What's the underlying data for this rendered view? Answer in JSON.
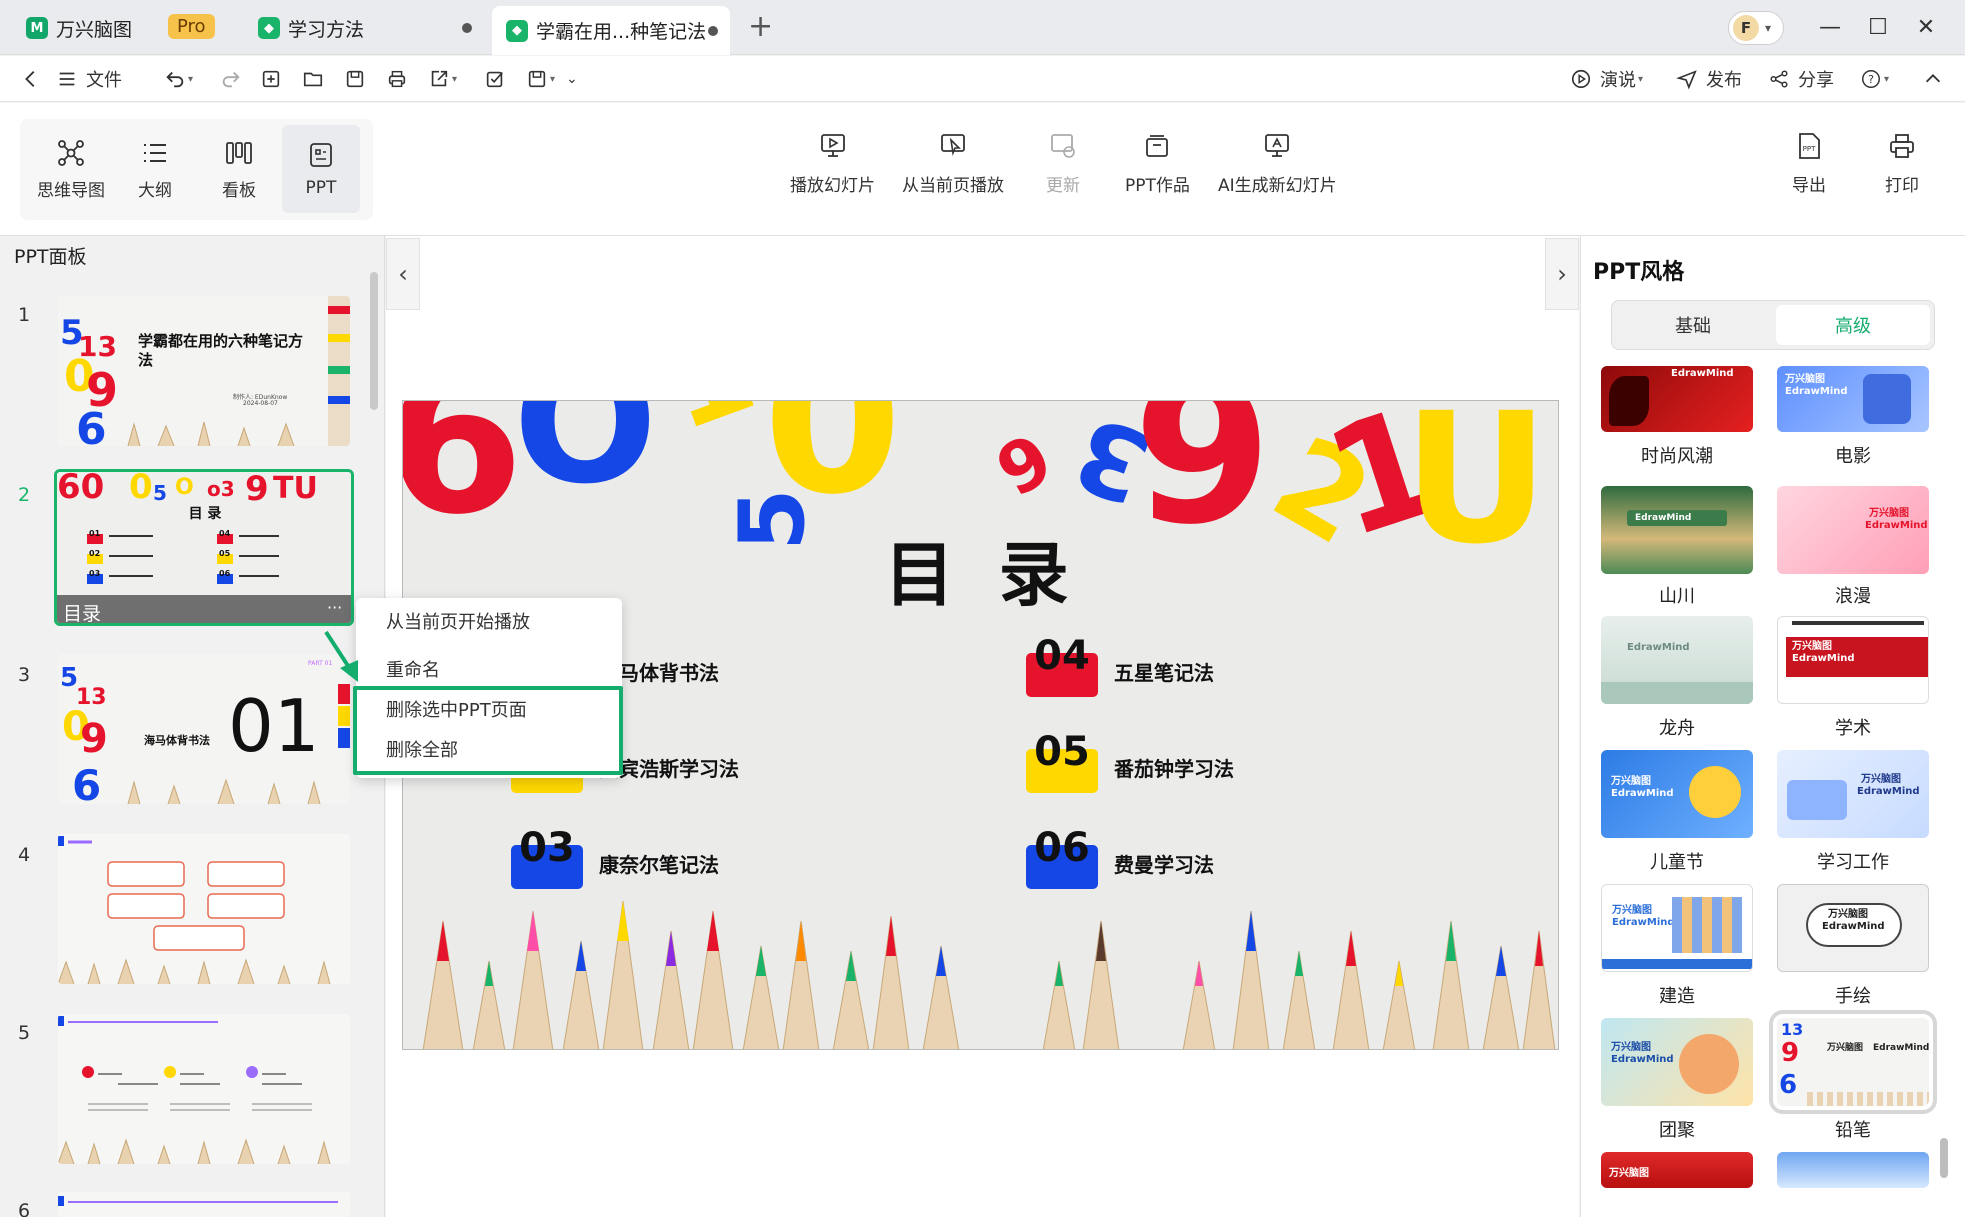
{
  "tabs": [
    {
      "label": "万兴脑图",
      "badge": "Pro"
    },
    {
      "label": "学习方法"
    },
    {
      "label": "学霸在用...种笔记法"
    }
  ],
  "avatar": {
    "initial": "F"
  },
  "menubar": {
    "file": "文件",
    "present": "演说",
    "publish": "发布",
    "share": "分享"
  },
  "view_modes": [
    {
      "label": "思维导图",
      "icon": "mindmap-icon"
    },
    {
      "label": "大纲",
      "icon": "outline-icon"
    },
    {
      "label": "看板",
      "icon": "kanban-icon"
    },
    {
      "label": "PPT",
      "icon": "ppt-icon"
    }
  ],
  "ribbon": {
    "play": "播放幻灯片",
    "play_current": "从当前页播放",
    "update": "更新",
    "ppt_works": "PPT作品",
    "ai_new": "AI生成新幻灯片",
    "export": "导出",
    "print": "打印"
  },
  "left_panel": {
    "title": "PPT面板",
    "slides": [
      {
        "num": "1",
        "title": "学霸都在用的六种笔记方法",
        "author": "制作人: EDunKnow",
        "date": "2024-08-07"
      },
      {
        "num": "2",
        "label": "目录",
        "more": "···"
      },
      {
        "num": "3",
        "big": "01",
        "text": "海马体背书法",
        "part": "PART 01"
      },
      {
        "num": "4"
      },
      {
        "num": "5"
      },
      {
        "num": "6"
      }
    ]
  },
  "context_menu": {
    "items": [
      "从当前页开始播放",
      "重命名",
      "删除选中PPT页面",
      "删除全部"
    ]
  },
  "slide": {
    "title": "目 录",
    "items": [
      {
        "num": "01",
        "text": "海马体背书法",
        "color": "#e5142c"
      },
      {
        "num": "02",
        "text": "艾宾浩斯学习法",
        "color": "#ffd800"
      },
      {
        "num": "03",
        "text": "康奈尔笔记法",
        "color": "#1547e6"
      },
      {
        "num": "04",
        "text": "五星笔记法",
        "color": "#e5142c"
      },
      {
        "num": "05",
        "text": "番茄钟学习法",
        "color": "#ffd800"
      },
      {
        "num": "06",
        "text": "费曼学习法",
        "color": "#1547e6"
      }
    ]
  },
  "right_panel": {
    "title": "PPT风格",
    "tabs": [
      "基础",
      "高级"
    ],
    "styles": [
      {
        "label": "时尚风潮"
      },
      {
        "label": "电影"
      },
      {
        "label": "山川"
      },
      {
        "label": "浪漫"
      },
      {
        "label": "龙舟"
      },
      {
        "label": "学术"
      },
      {
        "label": "儿童节"
      },
      {
        "label": "学习工作"
      },
      {
        "label": "建造"
      },
      {
        "label": "手绘"
      },
      {
        "label": "团聚"
      },
      {
        "label": "铅笔"
      }
    ],
    "brand_cn": "万兴脑图",
    "brand_en": "EdrawMind"
  },
  "colors": {
    "accent": "#14ad6d",
    "red": "#e5142c",
    "yellow": "#ffd800",
    "blue": "#1547e6"
  }
}
